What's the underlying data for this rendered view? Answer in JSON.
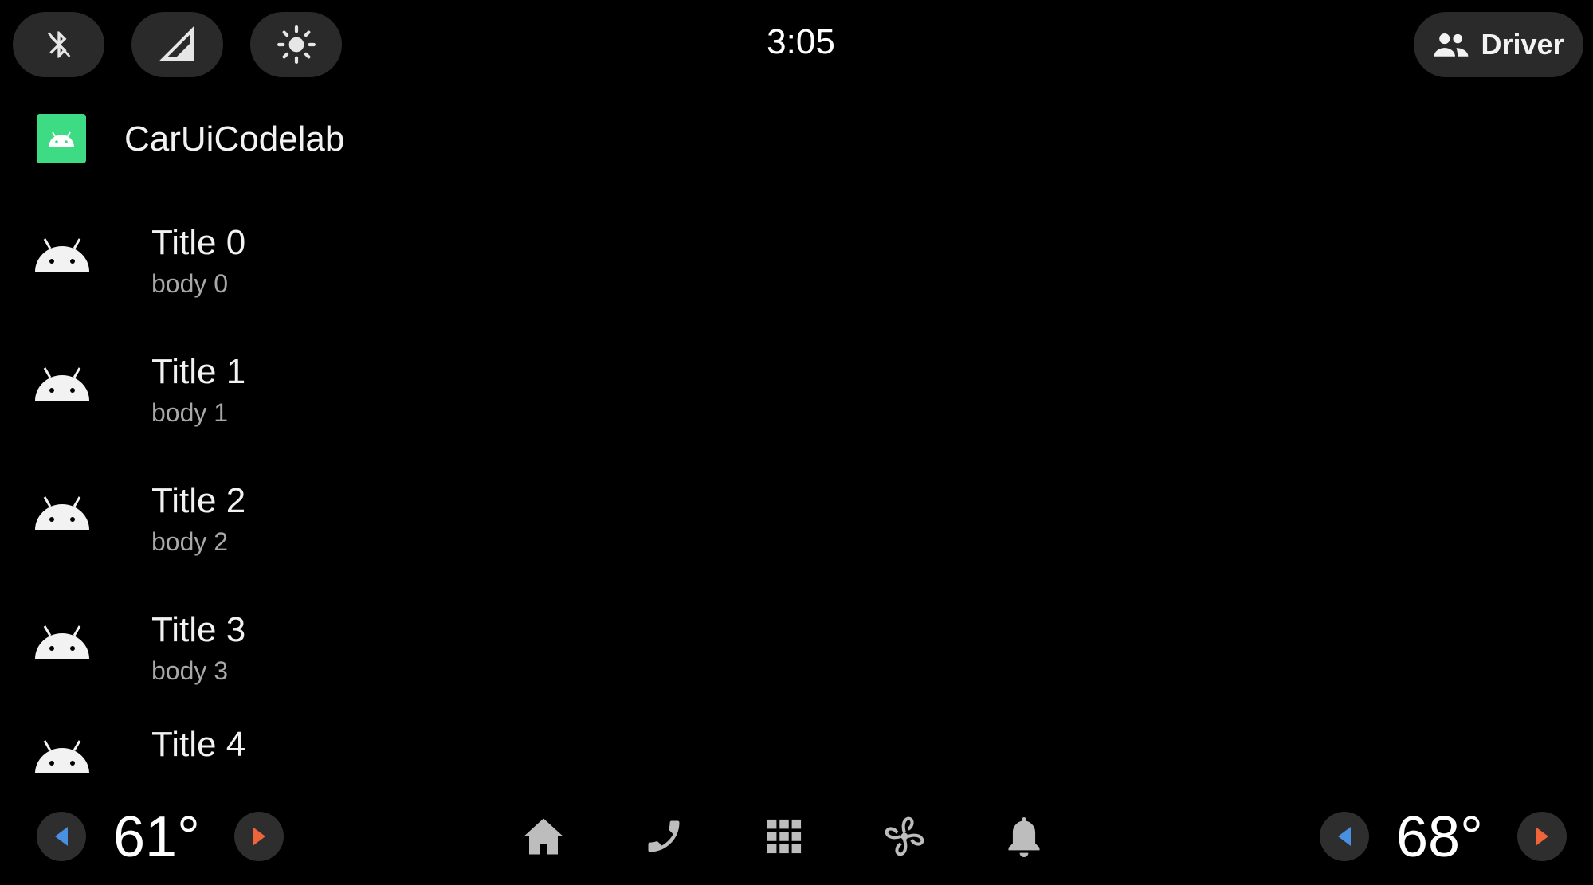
{
  "status_bar": {
    "clock": "3:05",
    "user_label": "Driver",
    "quick_settings": [
      "bluetooth-icon",
      "signal-icon",
      "brightness-icon"
    ]
  },
  "app": {
    "title": "CarUiCodelab",
    "accent": "#3ddc84"
  },
  "list": {
    "items": [
      {
        "title": "Title 0",
        "body": "body 0"
      },
      {
        "title": "Title 1",
        "body": "body 1"
      },
      {
        "title": "Title 2",
        "body": "body 2"
      },
      {
        "title": "Title 3",
        "body": "body 3"
      },
      {
        "title": "Title 4",
        "body": ""
      }
    ]
  },
  "hvac": {
    "left_temp": "61°",
    "right_temp": "68°",
    "decrease_color": "#4a90e2",
    "increase_color": "#f0643c"
  },
  "nav": {
    "icons": [
      "home-icon",
      "phone-icon",
      "apps-grid-icon",
      "fan-icon",
      "bell-icon"
    ]
  }
}
